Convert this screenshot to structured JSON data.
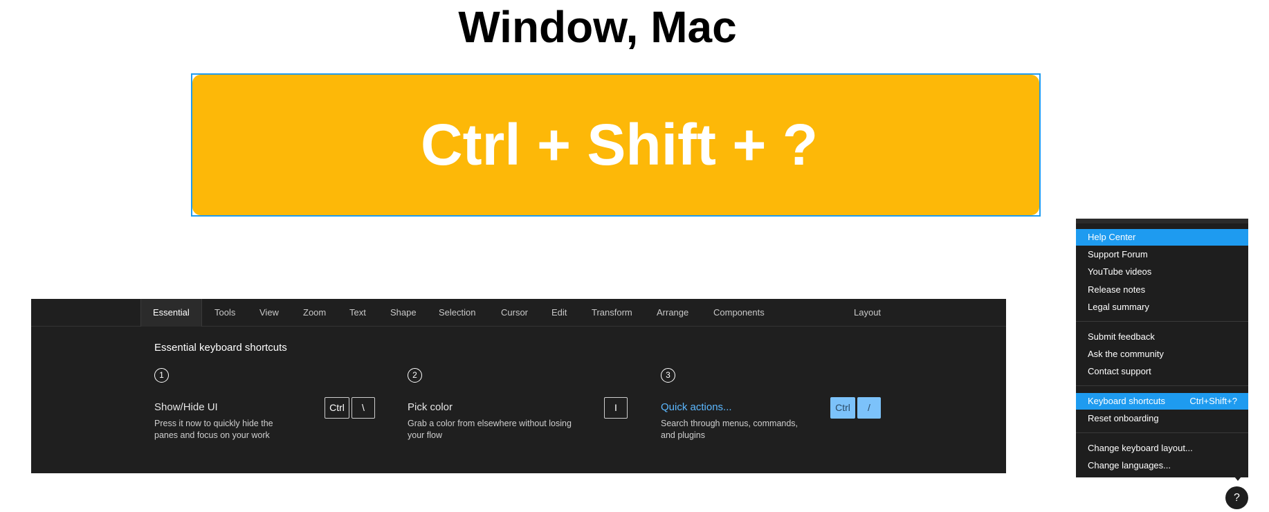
{
  "page": {
    "title": "Window, Mac"
  },
  "banner": {
    "shortcut": "Ctrl + Shift + ?"
  },
  "shortcuts_panel": {
    "tabs": [
      {
        "label": "Essential",
        "active": true
      },
      {
        "label": "Tools"
      },
      {
        "label": "View"
      },
      {
        "label": "Zoom"
      },
      {
        "label": "Text"
      },
      {
        "label": "Shape"
      },
      {
        "label": "Selection"
      },
      {
        "label": "Cursor"
      },
      {
        "label": "Edit"
      },
      {
        "label": "Transform"
      },
      {
        "label": "Arrange"
      },
      {
        "label": "Components"
      },
      {
        "label": "Layout"
      }
    ],
    "section_title": "Essential keyboard shortcuts",
    "shortcuts": [
      {
        "step": "1",
        "title": "Show/Hide UI",
        "desc_line1": "Press it now to quickly hide the",
        "desc_line2": "panes and focus on your work",
        "keys": [
          "Ctrl",
          "\\"
        ]
      },
      {
        "step": "2",
        "title": "Pick color",
        "desc_line1": "Grab a color from elsewhere without losing",
        "desc_line2": "your flow",
        "keys": [
          "I"
        ]
      },
      {
        "step": "3",
        "title": "Quick actions...",
        "desc_line1": "Search through menus, commands,",
        "desc_line2": "and plugins",
        "keys": [
          "Ctrl",
          "/"
        ]
      }
    ]
  },
  "help_menu": {
    "items": [
      {
        "label": "Help Center",
        "highlighted": true
      },
      {
        "label": "Support Forum"
      },
      {
        "label": "YouTube videos"
      },
      {
        "label": "Release notes"
      },
      {
        "label": "Legal summary"
      },
      {
        "label": "Submit feedback"
      },
      {
        "label": "Ask the community"
      },
      {
        "label": "Contact support"
      },
      {
        "label": "Keyboard shortcuts",
        "shortcut": "Ctrl+Shift+?",
        "highlighted": true
      },
      {
        "label": "Reset onboarding"
      },
      {
        "label": "Change keyboard layout..."
      },
      {
        "label": "Change languages..."
      }
    ],
    "help_button_label": "?"
  },
  "colors": {
    "banner": "#fdb808",
    "accent": "#1e9bf0",
    "panel_bg": "#1f1f1f",
    "key_highlight": "#7cc2fa"
  }
}
